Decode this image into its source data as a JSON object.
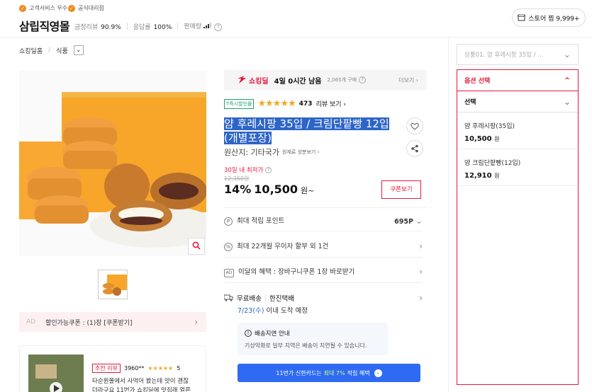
{
  "header": {
    "badge1": "고객서비스 우수",
    "badge2": "공식대리점",
    "store_name": "삼립직영몰",
    "review_label": "긍정리뷰",
    "review_value": "90.9%",
    "response_label": "응답률",
    "response_value": "100%",
    "sales_label": "판매량",
    "store_button": "스토어 찜 9,999+"
  },
  "breadcrumb": {
    "home": "쇼킹딜홈",
    "category": "식품"
  },
  "coupon_bar": {
    "ad": "AD",
    "text": "할인가능쿠폰 : (1)장 [쿠폰받기]"
  },
  "review_card": {
    "tag": "추천 리뷰",
    "user": "3960**",
    "score": "5",
    "text1": "타순원몰에서 사먹어 봤는데 맛이 괜찮",
    "text2": "더라구요 11번가 쇼킹딜에 맛집래 얼른"
  },
  "deal": {
    "label": "쇼킹딜",
    "remaining": "4일 0시간 남음",
    "buyers": "2,065개 구매",
    "more": "더보기"
  },
  "product": {
    "delivery_tag": "T즉시할인몰",
    "rating_count": "473",
    "rating_link": "리뷰 보기",
    "title_line1": "얌 후레시팡 35입 / 크림단팥빵 12입",
    "title_line2": "(개별포장)",
    "origin": "원산지: 기타국가",
    "origin_link": "원재료 성분보기",
    "lowest_label": "30일 내 최저가",
    "original_price": "12,350원",
    "discount": "14%",
    "price": "10,500",
    "price_unit": "원~",
    "coupon_button": "쿠폰보기"
  },
  "benefits": [
    {
      "icon": "P",
      "label": "최대 적립 포인트",
      "value": "695P"
    },
    {
      "icon": "%",
      "label": "최대 22개월 무이자 할부 외 1건",
      "value": ""
    },
    {
      "icon": "AD",
      "label": "이달의 혜택 : 장바구니쿠폰 1장 바로받기",
      "value": ""
    }
  ],
  "shipping": {
    "label": "무료배송",
    "carrier": "한진택배",
    "arrival_date": "7/23(수)",
    "arrival_text": "이내 도착 예정",
    "notice_title": "배송지연 안내",
    "notice_text": "기상악화로 일부 지역은 배송이 지연될 수 있습니다."
  },
  "card_banner": {
    "text": "11번가 신한카드는",
    "highlight": "최대 7%",
    "suffix": "적립 혜택"
  },
  "option_panel": {
    "select_preview": "상품01. 얌 후레시팡 35입 / ...",
    "header": "옵션 선택",
    "dropdown": "선택",
    "items": [
      {
        "name": "얌 후레시팡(35입)",
        "price": "10,500",
        "unit": "원"
      },
      {
        "name": "얌 크림단팥빵(12입)",
        "price": "12,910",
        "unit": "원"
      }
    ]
  },
  "colors": {
    "accent": "#e21a3c",
    "highlight": "#2d64c8",
    "banner": "#2f6bf2",
    "star": "#f5a623"
  }
}
